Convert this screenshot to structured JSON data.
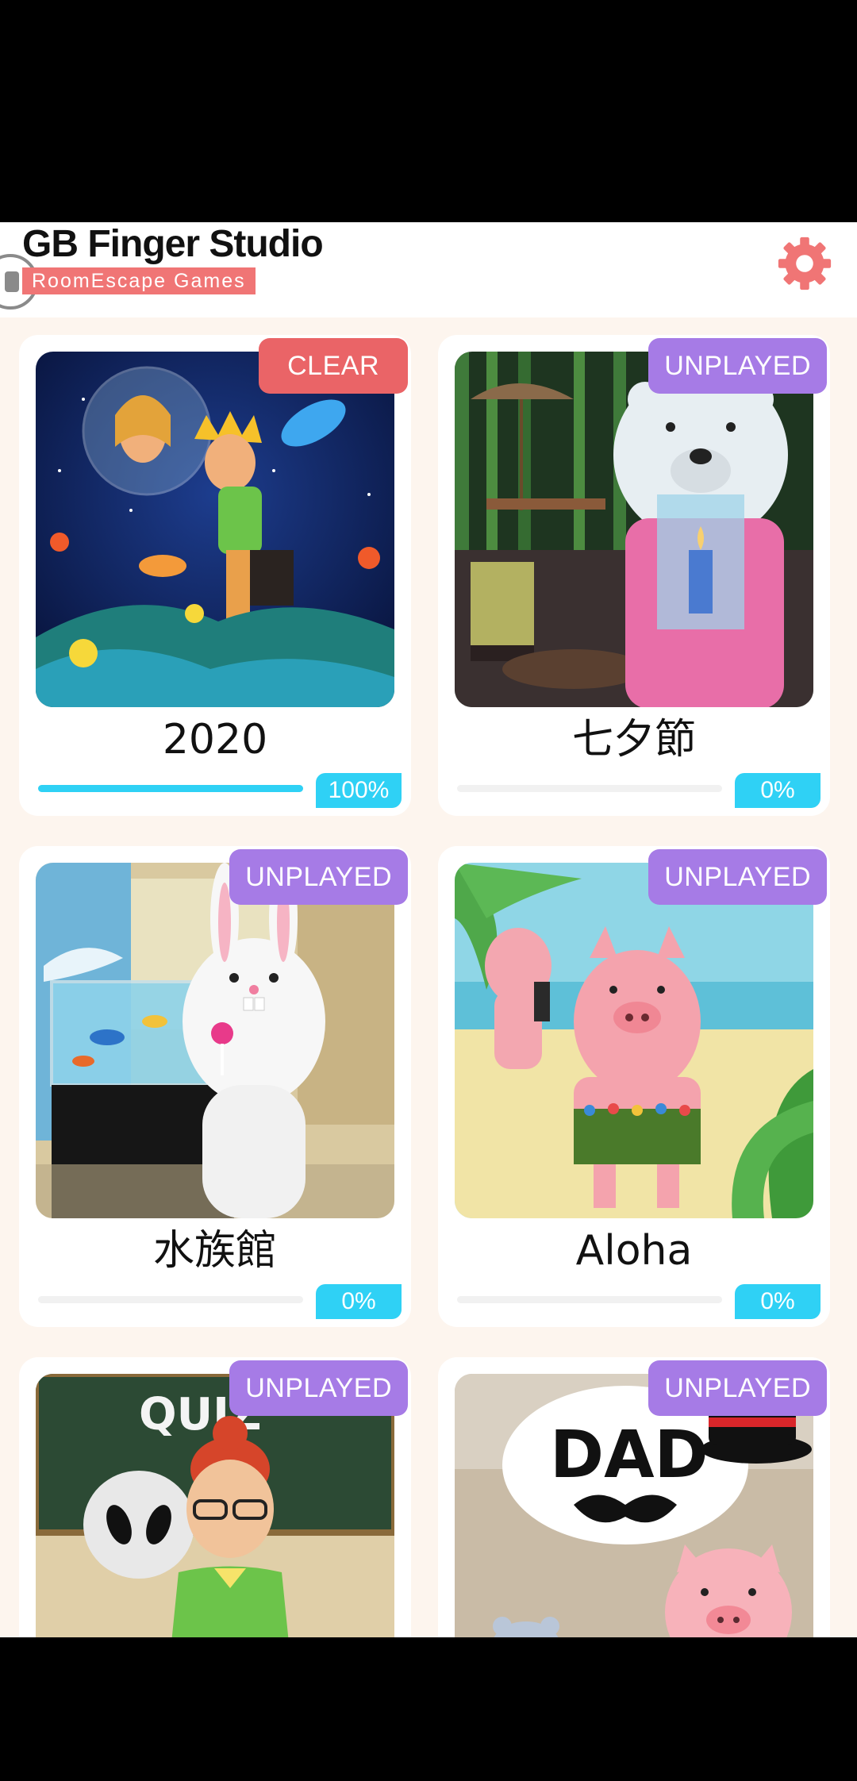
{
  "header": {
    "title": "GB Finger Studio",
    "subtitle": "RoomEscape  Games",
    "settings_icon": "gear-icon",
    "accent_color": "#f07575"
  },
  "games": [
    {
      "title": "2020",
      "badge": "CLEAR",
      "status": "clear",
      "progress_label": "100%",
      "progress": 1.0
    },
    {
      "title": "七夕節",
      "badge": "UNPLAYED",
      "status": "unplayed",
      "progress_label": "0%",
      "progress": 0
    },
    {
      "title": "水族館",
      "badge": "UNPLAYED",
      "status": "unplayed",
      "progress_label": "0%",
      "progress": 0
    },
    {
      "title": "Aloha",
      "badge": "UNPLAYED",
      "status": "unplayed",
      "progress_label": "0%",
      "progress": 0
    },
    {
      "title": "",
      "badge": "UNPLAYED",
      "status": "unplayed"
    },
    {
      "title": "",
      "badge": "UNPLAYED",
      "status": "unplayed"
    }
  ],
  "thumb_text": {
    "quiz": "QUIZ",
    "dad": "DAD"
  },
  "colors": {
    "clear_badge": "#ea6467",
    "unplayed_badge": "#a67be6",
    "progress": "#2fd1f5",
    "background": "#fdf5ee"
  }
}
